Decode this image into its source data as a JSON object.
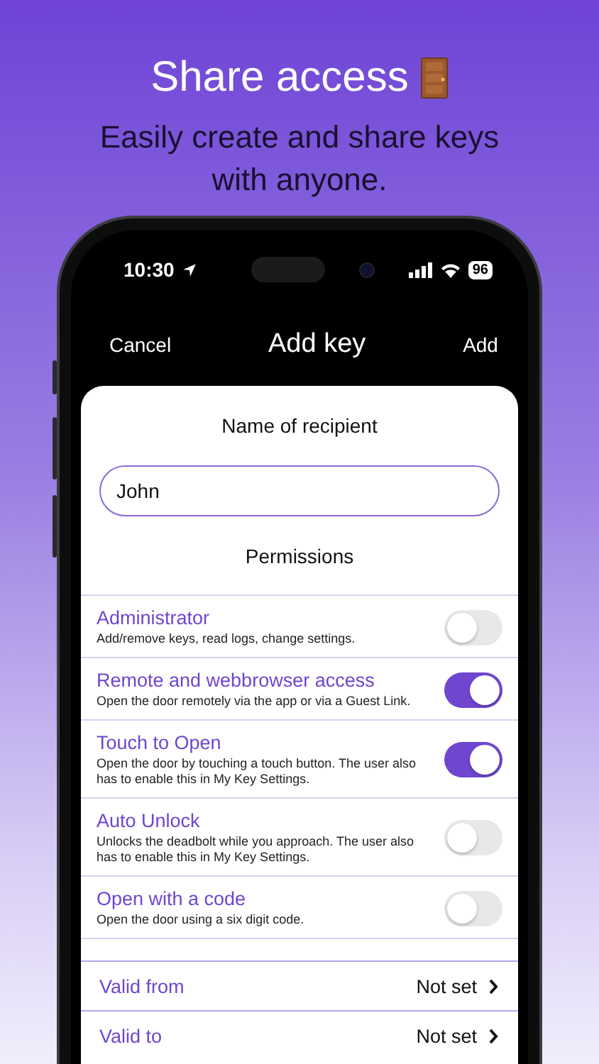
{
  "headline": {
    "title": "Share access",
    "subtitle": "Easily create and share keys with anyone."
  },
  "status_bar": {
    "time": "10:30",
    "battery": "96"
  },
  "nav": {
    "left": "Cancel",
    "title": "Add key",
    "right": "Add"
  },
  "recipient": {
    "label": "Name of recipient",
    "value": "John"
  },
  "permissions": {
    "title": "Permissions",
    "items": [
      {
        "title": "Administrator",
        "description": "Add/remove keys, read logs, change settings.",
        "on": false
      },
      {
        "title": "Remote and webbrowser access",
        "description": "Open the door remotely via the app or via a Guest Link.",
        "on": true
      },
      {
        "title": "Touch to Open",
        "description": "Open the door by touching a touch button. The user also has to enable this in My Key Settings.",
        "on": true
      },
      {
        "title": "Auto Unlock",
        "description": "Unlocks the deadbolt while you approach. The user also has to enable this in My Key Settings.",
        "on": false
      },
      {
        "title": "Open with a code",
        "description": "Open the door using a six digit code.",
        "on": false
      }
    ]
  },
  "validity": [
    {
      "label": "Valid from",
      "value": "Not set"
    },
    {
      "label": "Valid to",
      "value": "Not set"
    }
  ]
}
